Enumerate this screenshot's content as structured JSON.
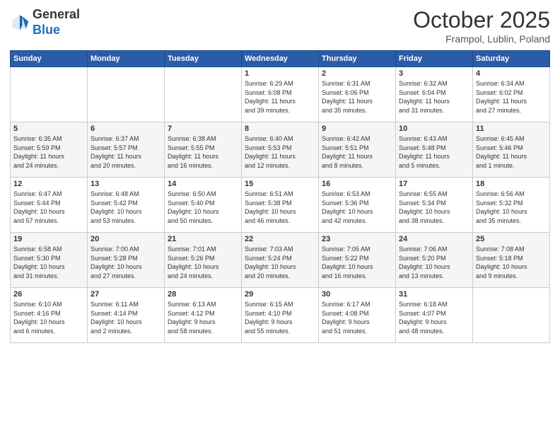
{
  "header": {
    "logo_general": "General",
    "logo_blue": "Blue",
    "month_title": "October 2025",
    "subtitle": "Frampol, Lublin, Poland"
  },
  "weekdays": [
    "Sunday",
    "Monday",
    "Tuesday",
    "Wednesday",
    "Thursday",
    "Friday",
    "Saturday"
  ],
  "weeks": [
    [
      {
        "day": "",
        "info": ""
      },
      {
        "day": "",
        "info": ""
      },
      {
        "day": "",
        "info": ""
      },
      {
        "day": "1",
        "info": "Sunrise: 6:29 AM\nSunset: 6:08 PM\nDaylight: 11 hours\nand 39 minutes."
      },
      {
        "day": "2",
        "info": "Sunrise: 6:31 AM\nSunset: 6:06 PM\nDaylight: 11 hours\nand 35 minutes."
      },
      {
        "day": "3",
        "info": "Sunrise: 6:32 AM\nSunset: 6:04 PM\nDaylight: 11 hours\nand 31 minutes."
      },
      {
        "day": "4",
        "info": "Sunrise: 6:34 AM\nSunset: 6:02 PM\nDaylight: 11 hours\nand 27 minutes."
      }
    ],
    [
      {
        "day": "5",
        "info": "Sunrise: 6:35 AM\nSunset: 5:59 PM\nDaylight: 11 hours\nand 24 minutes."
      },
      {
        "day": "6",
        "info": "Sunrise: 6:37 AM\nSunset: 5:57 PM\nDaylight: 11 hours\nand 20 minutes."
      },
      {
        "day": "7",
        "info": "Sunrise: 6:38 AM\nSunset: 5:55 PM\nDaylight: 11 hours\nand 16 minutes."
      },
      {
        "day": "8",
        "info": "Sunrise: 6:40 AM\nSunset: 5:53 PM\nDaylight: 11 hours\nand 12 minutes."
      },
      {
        "day": "9",
        "info": "Sunrise: 6:42 AM\nSunset: 5:51 PM\nDaylight: 11 hours\nand 8 minutes."
      },
      {
        "day": "10",
        "info": "Sunrise: 6:43 AM\nSunset: 5:48 PM\nDaylight: 11 hours\nand 5 minutes."
      },
      {
        "day": "11",
        "info": "Sunrise: 6:45 AM\nSunset: 5:46 PM\nDaylight: 11 hours\nand 1 minute."
      }
    ],
    [
      {
        "day": "12",
        "info": "Sunrise: 6:47 AM\nSunset: 5:44 PM\nDaylight: 10 hours\nand 57 minutes."
      },
      {
        "day": "13",
        "info": "Sunrise: 6:48 AM\nSunset: 5:42 PM\nDaylight: 10 hours\nand 53 minutes."
      },
      {
        "day": "14",
        "info": "Sunrise: 6:50 AM\nSunset: 5:40 PM\nDaylight: 10 hours\nand 50 minutes."
      },
      {
        "day": "15",
        "info": "Sunrise: 6:51 AM\nSunset: 5:38 PM\nDaylight: 10 hours\nand 46 minutes."
      },
      {
        "day": "16",
        "info": "Sunrise: 6:53 AM\nSunset: 5:36 PM\nDaylight: 10 hours\nand 42 minutes."
      },
      {
        "day": "17",
        "info": "Sunrise: 6:55 AM\nSunset: 5:34 PM\nDaylight: 10 hours\nand 38 minutes."
      },
      {
        "day": "18",
        "info": "Sunrise: 6:56 AM\nSunset: 5:32 PM\nDaylight: 10 hours\nand 35 minutes."
      }
    ],
    [
      {
        "day": "19",
        "info": "Sunrise: 6:58 AM\nSunset: 5:30 PM\nDaylight: 10 hours\nand 31 minutes."
      },
      {
        "day": "20",
        "info": "Sunrise: 7:00 AM\nSunset: 5:28 PM\nDaylight: 10 hours\nand 27 minutes."
      },
      {
        "day": "21",
        "info": "Sunrise: 7:01 AM\nSunset: 5:26 PM\nDaylight: 10 hours\nand 24 minutes."
      },
      {
        "day": "22",
        "info": "Sunrise: 7:03 AM\nSunset: 5:24 PM\nDaylight: 10 hours\nand 20 minutes."
      },
      {
        "day": "23",
        "info": "Sunrise: 7:05 AM\nSunset: 5:22 PM\nDaylight: 10 hours\nand 16 minutes."
      },
      {
        "day": "24",
        "info": "Sunrise: 7:06 AM\nSunset: 5:20 PM\nDaylight: 10 hours\nand 13 minutes."
      },
      {
        "day": "25",
        "info": "Sunrise: 7:08 AM\nSunset: 5:18 PM\nDaylight: 10 hours\nand 9 minutes."
      }
    ],
    [
      {
        "day": "26",
        "info": "Sunrise: 6:10 AM\nSunset: 4:16 PM\nDaylight: 10 hours\nand 6 minutes."
      },
      {
        "day": "27",
        "info": "Sunrise: 6:11 AM\nSunset: 4:14 PM\nDaylight: 10 hours\nand 2 minutes."
      },
      {
        "day": "28",
        "info": "Sunrise: 6:13 AM\nSunset: 4:12 PM\nDaylight: 9 hours\nand 58 minutes."
      },
      {
        "day": "29",
        "info": "Sunrise: 6:15 AM\nSunset: 4:10 PM\nDaylight: 9 hours\nand 55 minutes."
      },
      {
        "day": "30",
        "info": "Sunrise: 6:17 AM\nSunset: 4:08 PM\nDaylight: 9 hours\nand 51 minutes."
      },
      {
        "day": "31",
        "info": "Sunrise: 6:18 AM\nSunset: 4:07 PM\nDaylight: 9 hours\nand 48 minutes."
      },
      {
        "day": "",
        "info": ""
      }
    ]
  ]
}
